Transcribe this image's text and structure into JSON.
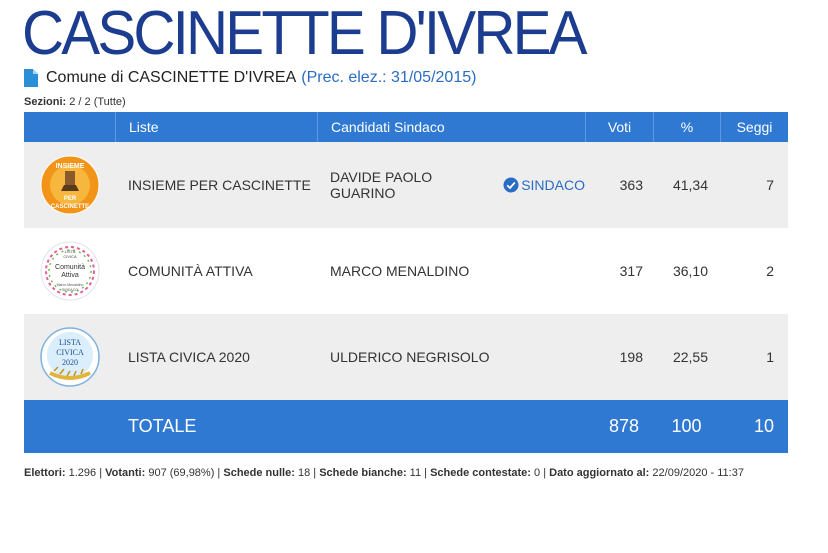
{
  "page": {
    "title": "CASCINETTE D'IVREA",
    "subtitle": "Comune di CASCINETTE D'IVREA",
    "prev_election": "(Prec. elez.: 31/05/2015)",
    "sezioni_label": "Sezioni:",
    "sezioni_value": "2 / 2 (Tutte)"
  },
  "table": {
    "headers": {
      "liste": "Liste",
      "candidati": "Candidati Sindaco",
      "voti": "Voti",
      "pct": "%",
      "seggi": "Seggi"
    },
    "rows": [
      {
        "list": "INSIEME PER CASCINETTE",
        "candidate": "DAVIDE PAOLO GUARINO",
        "badge": "SINDACO",
        "votes": "363",
        "pct": "41,34",
        "seats": "7",
        "logo": "insieme-per-cascinette-logo",
        "logo_text_top": "INSIEME",
        "logo_text_bottom": "CASCINETTE",
        "logo_text_mid": "PER"
      },
      {
        "list": "COMUNITÀ ATTIVA",
        "candidate": "MARCO MENALDINO",
        "votes": "317",
        "pct": "36,10",
        "seats": "2",
        "logo": "comunita-attiva-logo",
        "logo_line1": "LISTA",
        "logo_line2": "CIVICA",
        "logo_line3": "Comunità",
        "logo_line4": "Attiva",
        "logo_line5": "Marco Menaldino",
        "logo_line6": "SINDACO"
      },
      {
        "list": "LISTA CIVICA 2020",
        "candidate": "ULDERICO NEGRISOLO",
        "votes": "198",
        "pct": "22,55",
        "seats": "1",
        "logo": "lista-civica-2020-logo",
        "logo_line1": "LISTA",
        "logo_line2": "CIVICA",
        "logo_line3": "2020"
      }
    ],
    "total": {
      "label": "TOTALE",
      "votes": "878",
      "pct": "100",
      "seats": "10"
    }
  },
  "footer": {
    "elettori_label": "Elettori:",
    "elettori_value": "1.296",
    "votanti_label": "Votanti:",
    "votanti_value": "907 (69,98%)",
    "nulle_label": "Schede nulle:",
    "nulle_value": "18",
    "bianche_label": "Schede bianche:",
    "bianche_value": "11",
    "contestate_label": "Schede contestate:",
    "contestate_value": "0",
    "aggiornato_label": "Dato aggiornato al:",
    "aggiornato_value": "22/09/2020 - 11:37"
  },
  "colors": {
    "title": "#1c3d8f",
    "header_bg": "#2f79d3",
    "link": "#2a6cc4",
    "row_shade": "#eeeeee"
  }
}
